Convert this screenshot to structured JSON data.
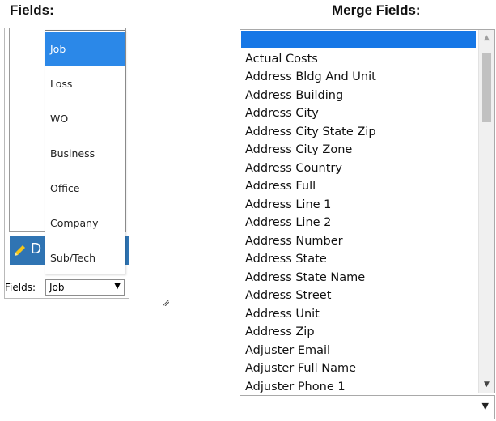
{
  "headings": {
    "left": "Fields:",
    "right": "Merge Fields:"
  },
  "left_panel": {
    "strip_partial_text": "D",
    "strip_partial_text_right": "",
    "fields_label": "Fields:",
    "fields_select_value": "Job"
  },
  "dropdown": {
    "items": [
      "Job",
      "Loss",
      "WO",
      "Business",
      "Office",
      "Company",
      "Sub/Tech"
    ],
    "selected": "Job"
  },
  "merge_fields": {
    "selected_value": "",
    "items": [
      "Actual Costs",
      "Address Bldg And Unit",
      "Address Building",
      "Address City",
      "Address City State Zip",
      "Address City Zone",
      "Address Country",
      "Address Full",
      "Address Line 1",
      "Address Line 2",
      "Address Number",
      "Address State",
      "Address State Name",
      "Address Street",
      "Address Unit",
      "Address Zip",
      "Adjuster Email",
      "Adjuster Full Name",
      "Adjuster Phone 1"
    ]
  },
  "colors": {
    "selection_blue": "#1677e6",
    "dropdown_selected": "#2b88e8",
    "strip_blue": "#2f74b3"
  },
  "icons": {
    "pencil": "pencil-icon",
    "dropdown_arrow": "triangle-down-icon",
    "scroll_up": "scroll-up-arrow-icon",
    "scroll_down": "scroll-down-arrow-icon"
  }
}
